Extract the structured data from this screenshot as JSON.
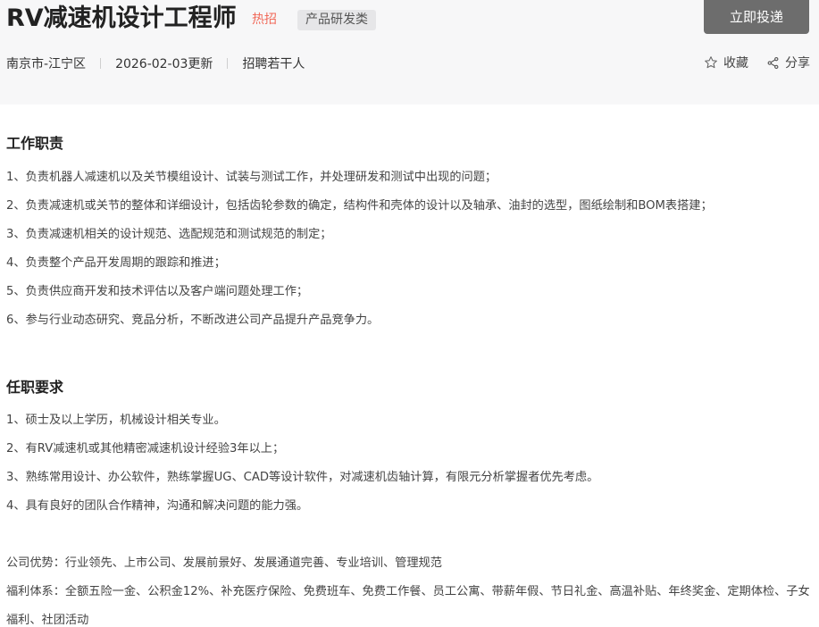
{
  "job": {
    "title": "RV减速机设计工程师",
    "hot_tag": "热招",
    "category_tag": "产品研发类",
    "apply_label": "立即投递",
    "location": "南京市-江宁区",
    "updated": "2026-02-03更新",
    "headcount": "招聘若干人",
    "favorite_label": "收藏",
    "share_label": "分享"
  },
  "duties": {
    "heading": "工作职责",
    "items": [
      "1、负责机器人减速机以及关节模组设计、试装与测试工作，并处理研发和测试中出现的问题；",
      "2、负责减速机或关节的整体和详细设计，包括齿轮参数的确定，结构件和壳体的设计以及轴承、油封的选型，图纸绘制和BOM表搭建；",
      "3、负责减速机相关的设计规范、选配规范和测试规范的制定；",
      "4、负责整个产品开发周期的跟踪和推进；",
      "5、负责供应商开发和技术评估以及客户端问题处理工作；",
      "6、参与行业动态研究、竞品分析，不断改进公司产品提升产品竞争力。"
    ]
  },
  "requirements": {
    "heading": "任职要求",
    "items": [
      "1、硕士及以上学历，机械设计相关专业。",
      "2、有RV减速机或其他精密减速机设计经验3年以上；",
      "3、熟练常用设计、办公软件，熟练掌握UG、CAD等设计软件，对减速机齿轴计算，有限元分析掌握者优先考虑。",
      "4、具有良好的团队合作精神，沟通和解决问题的能力强。"
    ]
  },
  "extras": {
    "advantages": "公司优势：行业领先、上市公司、发展前景好、发展通道完善、专业培训、管理规范",
    "benefits": "福利体系：全额五险一金、公积金12%、补充医疗保险、免费班车、免费工作餐、员工公寓、带薪年假、节日礼金、高温补贴、年终奖金、定期体检、子女福利、社团活动"
  }
}
